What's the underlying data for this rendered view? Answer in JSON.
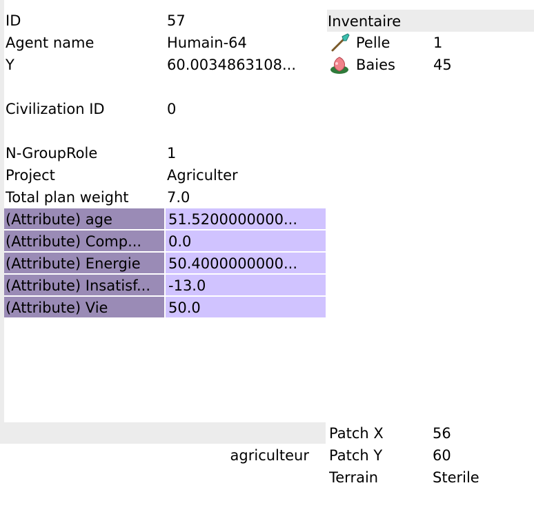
{
  "agent": {
    "rows": [
      {
        "label": "ID",
        "value": "57"
      },
      {
        "label": "Agent name",
        "value": "Humain-64"
      },
      {
        "label": "Y",
        "value": "60.0034863108..."
      },
      {
        "label": "Civilization ID",
        "value": "0"
      },
      {
        "label": "N-GroupRole",
        "value": "1"
      },
      {
        "label": "Project",
        "value": "Agriculter"
      },
      {
        "label": "Total plan weight",
        "value": "7.0"
      }
    ],
    "attributes": [
      {
        "label": "(Attribute) age",
        "value": "51.5200000000..."
      },
      {
        "label": "(Attribute) Comp...",
        "value": "0.0"
      },
      {
        "label": "(Attribute) Energie",
        "value": "50.4000000000..."
      },
      {
        "label": "(Attribute) Insatisf...",
        "value": "-13.0"
      },
      {
        "label": "(Attribute) Vie",
        "value": "50.0"
      }
    ]
  },
  "inventory": {
    "title": "Inventaire",
    "items": [
      {
        "icon": "shovel-icon",
        "name": "Pelle",
        "count": "1"
      },
      {
        "icon": "berries-icon",
        "name": "Baies",
        "count": "45"
      }
    ]
  },
  "role_label": "agriculteur",
  "patch": {
    "rows": [
      {
        "label": "Patch X",
        "value": "56"
      },
      {
        "label": "Patch Y",
        "value": "60"
      },
      {
        "label": "Terrain",
        "value": "Sterile"
      }
    ]
  },
  "colors": {
    "attr_key_bg": "#9a8bb6",
    "attr_value_bg": "#d0c3ff",
    "panel_gray": "#ececec"
  }
}
